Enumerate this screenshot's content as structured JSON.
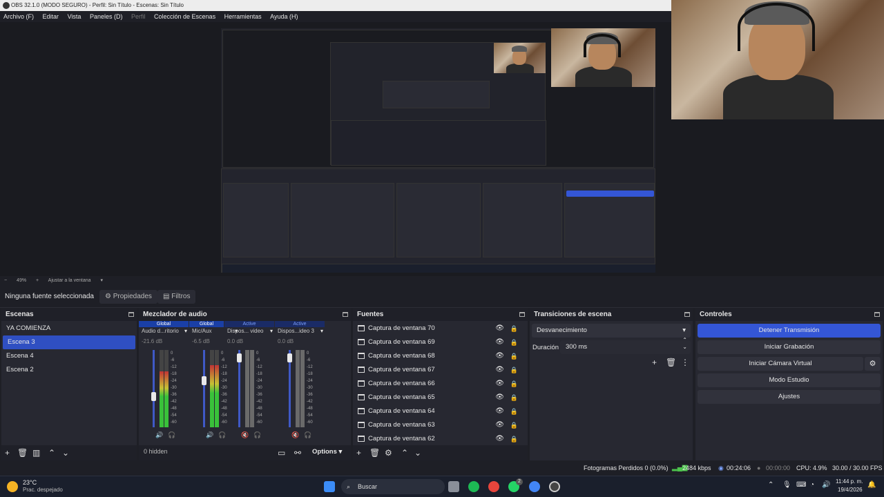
{
  "window": {
    "title": "OBS 32.1.0 (MODO SEGURO) - Perfil: Sin Título - Escenas: Sin Título"
  },
  "menu": [
    {
      "label": "Archivo (F)",
      "enabled": true
    },
    {
      "label": "Editar",
      "enabled": true
    },
    {
      "label": "Vista",
      "enabled": true
    },
    {
      "label": "Paneles (D)",
      "enabled": true
    },
    {
      "label": "Perfil",
      "enabled": false
    },
    {
      "label": "Colección de Escenas",
      "enabled": true
    },
    {
      "label": "Herramientas",
      "enabled": true
    },
    {
      "label": "Ayuda (H)",
      "enabled": true
    }
  ],
  "zoom": {
    "minus": "−",
    "value": "49%",
    "plus": "+",
    "fit": "Ajustar a la ventana"
  },
  "source_toolbar": {
    "no_source": "Ninguna fuente seleccionada",
    "properties": "Propiedades",
    "filters": "Filtros"
  },
  "scenes": {
    "title": "Escenas",
    "items": [
      "YA COMIENZA",
      "Escena 3",
      "Escena 4",
      "Escena 2"
    ],
    "selected_index": 1
  },
  "mixer": {
    "title": "Mezclador de audio",
    "channels": [
      {
        "header": "Global",
        "name": "Audio d...ritorio",
        "db": "-21.6 dB",
        "level": 0.72,
        "fader": 0.38,
        "muted": false
      },
      {
        "header": "Global",
        "name": "Mic/Aux",
        "db": "-6.5 dB",
        "level": 0.8,
        "fader": 0.62,
        "muted": false
      },
      {
        "header": "Active",
        "name": "Dispos... video",
        "db": "0.0 dB",
        "level": 0.0,
        "fader": 0.95,
        "muted": true
      },
      {
        "header": "Active",
        "name": "Dispos...ideo 3",
        "db": "0.0 dB",
        "level": 0.0,
        "fader": 0.95,
        "muted": true
      }
    ],
    "scale": [
      "0",
      "-6",
      "-12",
      "-18",
      "-24",
      "-30",
      "-36",
      "-42",
      "-48",
      "-54",
      "-60"
    ],
    "hidden": "0 hidden",
    "options": "Options"
  },
  "sources": {
    "title": "Fuentes",
    "items": [
      "Captura de ventana 70",
      "Captura de ventana 69",
      "Captura de ventana 68",
      "Captura de ventana 67",
      "Captura de ventana 66",
      "Captura de ventana 65",
      "Captura de ventana 64",
      "Captura de ventana 63",
      "Captura de ventana 62"
    ]
  },
  "transitions": {
    "title": "Transiciones de escena",
    "selected": "Desvanecimiento",
    "duration_label": "Duración",
    "duration_value": "300 ms"
  },
  "controls": {
    "title": "Controles",
    "stop_stream": "Detener Transmisión",
    "start_recording": "Iniciar Grabación",
    "start_virtual_cam": "Iniciar Cámara Virtual",
    "studio_mode": "Modo Estudio",
    "settings": "Ajustes"
  },
  "status": {
    "dropped": "Fotogramas Perdidos 0 (0.0%)",
    "bitrate": "2484 kbps",
    "stream_time": "00:24:06",
    "rec_time": "00:00:00",
    "cpu": "CPU: 4.9%",
    "fps": "30.00 / 30.00 FPS"
  },
  "taskbar": {
    "weather_temp": "23°C",
    "weather_desc": "Prac. despejado",
    "search": "Buscar",
    "time": "11:44 p. m.",
    "date": "19/4/2026",
    "badge": "2"
  },
  "colors": {
    "accent": "#3456d6",
    "panel": "#272831",
    "background": "#1e1f26"
  }
}
